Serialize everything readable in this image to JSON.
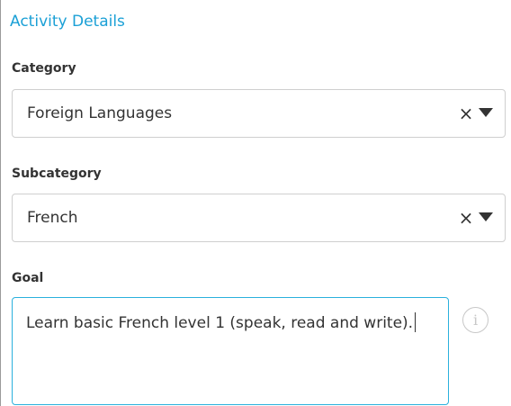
{
  "section": {
    "title": "Activity Details"
  },
  "category": {
    "label": "Category",
    "value": "Foreign Languages",
    "clear_glyph": "×"
  },
  "subcategory": {
    "label": "Subcategory",
    "value": "French",
    "clear_glyph": "×"
  },
  "goal": {
    "label": "Goal",
    "value": "Learn basic French level 1 (speak, read and write).",
    "info_glyph": "i"
  },
  "colors": {
    "accent": "#1ba0d6",
    "focus_border": "#2ab0dd",
    "text": "#333333",
    "border": "#cfcfcf"
  },
  "icons": {
    "clear": "close-icon",
    "dropdown": "caret-down-icon",
    "info": "info-icon"
  }
}
